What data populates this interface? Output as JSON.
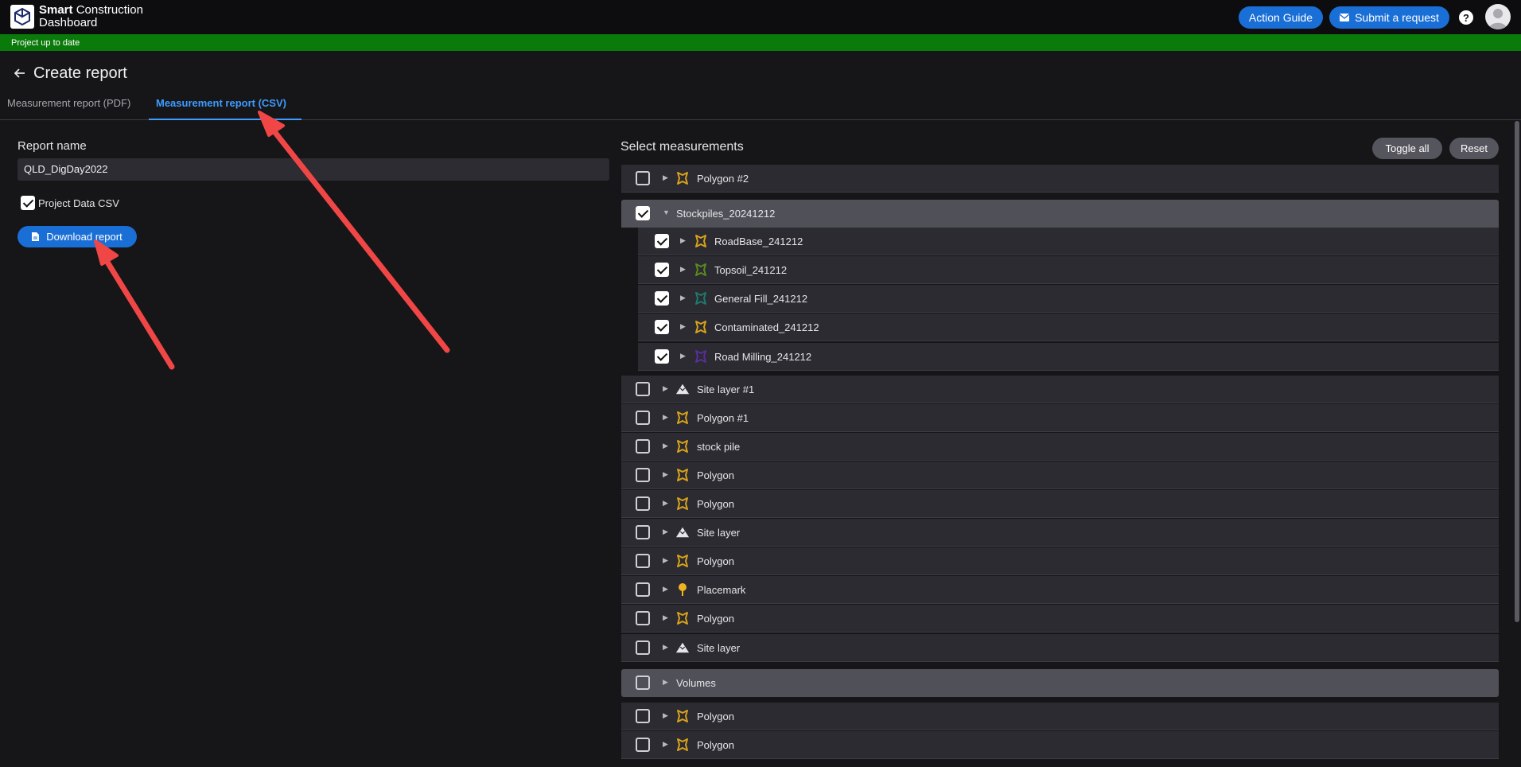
{
  "app": {
    "logo_line1_bold": "Smart",
    "logo_line1_rest": " Construction",
    "logo_line2": "Dashboard"
  },
  "header": {
    "action_guide": "Action Guide",
    "submit_request": "Submit a request",
    "help": "?"
  },
  "status": {
    "text": "Project up to date",
    "color": "#0a7a0a"
  },
  "page": {
    "title": "Create report",
    "back_icon": "arrow-left-icon"
  },
  "tabs": [
    {
      "label": "Measurement report (PDF)",
      "active": false
    },
    {
      "label": "Measurement report (CSV)",
      "active": true
    }
  ],
  "form": {
    "report_name_label": "Report name",
    "report_name_value": "QLD_DigDay2022",
    "project_data_csv_label": "Project Data CSV",
    "project_data_csv_checked": true,
    "download_label": "Download report"
  },
  "measurements": {
    "title": "Select measurements",
    "toggle_all": "Toggle all",
    "reset": "Reset",
    "rows": [
      {
        "label": "Polygon #2",
        "icon": "polygon-icon",
        "icon_color": "#d9a21b",
        "checked": false,
        "kind": "item"
      },
      {
        "label": "Stockpiles_20241212",
        "icon": "",
        "checked": true,
        "kind": "group-open"
      },
      {
        "label": "RoadBase_241212",
        "icon": "polygon-icon",
        "icon_color": "#d9a21b",
        "checked": true,
        "kind": "child"
      },
      {
        "label": "Topsoil_241212",
        "icon": "polygon-icon",
        "icon_color": "#5a8a1e",
        "checked": true,
        "kind": "child"
      },
      {
        "label": "General Fill_241212",
        "icon": "polygon-icon",
        "icon_color": "#1f7a6e",
        "checked": true,
        "kind": "child"
      },
      {
        "label": "Contaminated_241212",
        "icon": "polygon-icon",
        "icon_color": "#d9a21b",
        "checked": true,
        "kind": "child"
      },
      {
        "label": "Road Milling_241212",
        "icon": "polygon-icon",
        "icon_color": "#5a2d9a",
        "checked": true,
        "kind": "child"
      },
      {
        "label": "Site layer #1",
        "icon": "mountain-icon",
        "icon_color": "#e6e6e8",
        "checked": false,
        "kind": "item"
      },
      {
        "label": "Polygon #1",
        "icon": "polygon-icon",
        "icon_color": "#d9a21b",
        "checked": false,
        "kind": "item"
      },
      {
        "label": "stock pile",
        "icon": "polygon-icon",
        "icon_color": "#d9a21b",
        "checked": false,
        "kind": "item"
      },
      {
        "label": "Polygon",
        "icon": "polygon-icon",
        "icon_color": "#d9a21b",
        "checked": false,
        "kind": "item"
      },
      {
        "label": "Polygon",
        "icon": "polygon-icon",
        "icon_color": "#d9a21b",
        "checked": false,
        "kind": "item"
      },
      {
        "label": "Site layer",
        "icon": "mountain-icon",
        "icon_color": "#e6e6e8",
        "checked": false,
        "kind": "item"
      },
      {
        "label": "Polygon",
        "icon": "polygon-icon",
        "icon_color": "#d9a21b",
        "checked": false,
        "kind": "item"
      },
      {
        "label": "Placemark",
        "icon": "pin-icon",
        "icon_color": "#f0b323",
        "checked": false,
        "kind": "item"
      },
      {
        "label": "Polygon",
        "icon": "polygon-icon",
        "icon_color": "#d9a21b",
        "checked": false,
        "kind": "item"
      },
      {
        "label": "Site layer",
        "icon": "mountain-icon",
        "icon_color": "#e6e6e8",
        "checked": false,
        "kind": "item"
      },
      {
        "label": "Volumes",
        "icon": "",
        "checked": false,
        "kind": "group-closed"
      },
      {
        "label": "Polygon",
        "icon": "polygon-icon",
        "icon_color": "#d9a21b",
        "checked": false,
        "kind": "item"
      },
      {
        "label": "Polygon",
        "icon": "polygon-icon",
        "icon_color": "#d9a21b",
        "checked": false,
        "kind": "item"
      }
    ]
  },
  "colors": {
    "accent": "#1a6fd6",
    "tab_active": "#3e9bff",
    "annotation_arrow": "#f04646"
  }
}
